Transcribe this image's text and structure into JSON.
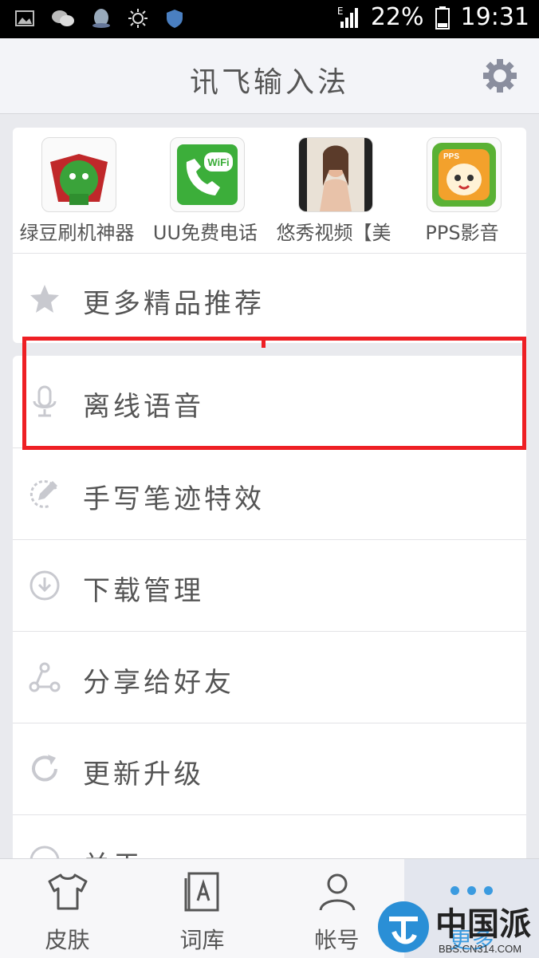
{
  "status_bar": {
    "signal_label": "E",
    "battery": "22%",
    "time": "19:31"
  },
  "header": {
    "title": "讯飞输入法"
  },
  "apps": [
    {
      "name": "绿豆刷机神器"
    },
    {
      "name": "UU免费电话"
    },
    {
      "name": "悠秀视频【美"
    },
    {
      "name": "PPS影音"
    }
  ],
  "app_badges": {
    "wifi": "WiFi",
    "pps": "PPS"
  },
  "more": {
    "label": "更多精品推荐"
  },
  "menu": [
    {
      "label": "离线语音",
      "icon": "microphone-icon"
    },
    {
      "label": "手写笔迹特效",
      "icon": "pen-icon"
    },
    {
      "label": "下载管理",
      "icon": "download-icon"
    },
    {
      "label": "分享给好友",
      "icon": "share-icon"
    },
    {
      "label": "更新升级",
      "icon": "refresh-icon"
    },
    {
      "label": "关于",
      "icon": "info-icon"
    }
  ],
  "tabs": [
    {
      "label": "皮肤",
      "icon": "shirt-icon"
    },
    {
      "label": "词库",
      "icon": "dictionary-icon"
    },
    {
      "label": "帐号",
      "icon": "account-icon"
    },
    {
      "label": "更多",
      "icon": "more-dots-icon"
    }
  ],
  "watermark": {
    "text": "中国派",
    "url": "BBS.CN314.COM"
  },
  "colors": {
    "highlight": "#ee1f24",
    "accent": "#3b9be0",
    "text": "#555555"
  }
}
